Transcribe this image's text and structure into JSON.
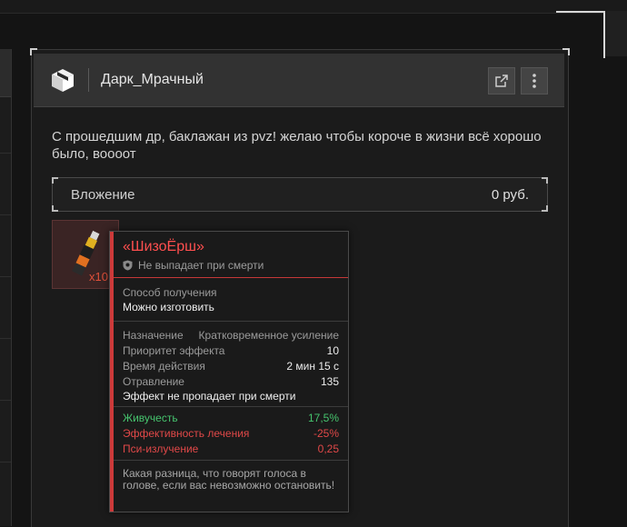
{
  "message": {
    "author": "Дарк_Мрачный",
    "text": "С прошедшим др, баклажан из pvz! желаю чтобы короче в жизни всё хорошо было, воооот",
    "attachment_label": "Вложение",
    "attachment_value": "0 руб."
  },
  "item": {
    "count": "x10",
    "icon": "bottle-icon",
    "name": "«ШизоЁрш»",
    "drop_note": "Не выпадает при смерти",
    "source_label": "Способ получения",
    "source_value": "Можно изготовить",
    "purpose_label": "Назначение",
    "purpose_value": "Кратковременное усиление",
    "priority_label": "Приоритет эффекта",
    "priority_value": "10",
    "duration_label": "Время действия",
    "duration_value": "2 мин 15 с",
    "poison_label": "Отравление",
    "poison_value": "135",
    "persist_note": "Эффект не пропадает при смерти",
    "stats": [
      {
        "label": "Живучесть",
        "value": "17,5%",
        "tone": "green"
      },
      {
        "label": "Эффективность лечения",
        "value": "-25%",
        "tone": "red"
      },
      {
        "label": "Пси-излучение",
        "value": "0,25",
        "tone": "red"
      }
    ],
    "description": "Какая разница, что говорят голоса в голове, если вас невозможно остановить!"
  },
  "colors": {
    "accent_red": "#cc3a3a",
    "positive": "#46c46e",
    "negative": "#e04848"
  }
}
